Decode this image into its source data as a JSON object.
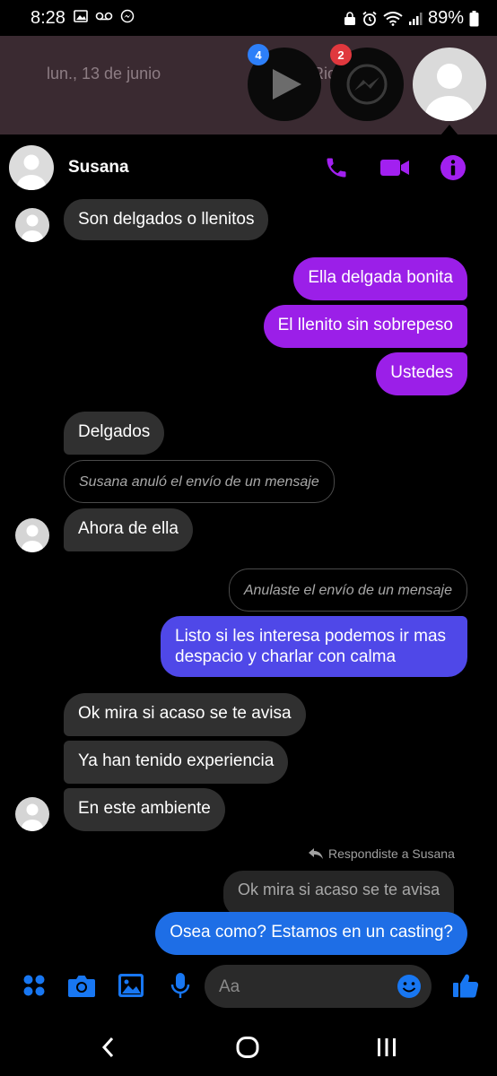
{
  "status_bar": {
    "time": "8:28",
    "battery": "89%"
  },
  "background": {
    "date": "lun., 13 de junio",
    "name_partial": "Ric       ida"
  },
  "bubble_heads": [
    {
      "badge": "4",
      "badge_color": "#2d7ff9"
    },
    {
      "badge": "2",
      "badge_color": "#e0383e"
    }
  ],
  "chat_header": {
    "contact_name": "Susana"
  },
  "messages": {
    "m1": "Son delgados o llenitos",
    "m2": "Ella delgada bonita",
    "m3": "El llenito sin sobrepeso",
    "m4": "Ustedes",
    "m5": "Delgados",
    "n1": "Susana anuló el envío de un mensaje",
    "m6": "Ahora de ella",
    "n2": "Anulaste el envío de un mensaje",
    "m7_line1": "Listo si les interesa podemos ir mas",
    "m7_line2": "despacio y charlar con calma",
    "m8": "Ok mira si acaso se te avisa",
    "m9": "Ya han tenido experiencia",
    "m10": "En este ambiente",
    "reply_label": "Respondiste a Susana",
    "quoted": "Ok mira si acaso se te avisa",
    "m11": "Osea como? Estamos en un casting?"
  },
  "composer": {
    "placeholder": "Aa"
  },
  "colors": {
    "accent_purple": "#9b1fe8",
    "accent_blue": "#1877f2"
  }
}
